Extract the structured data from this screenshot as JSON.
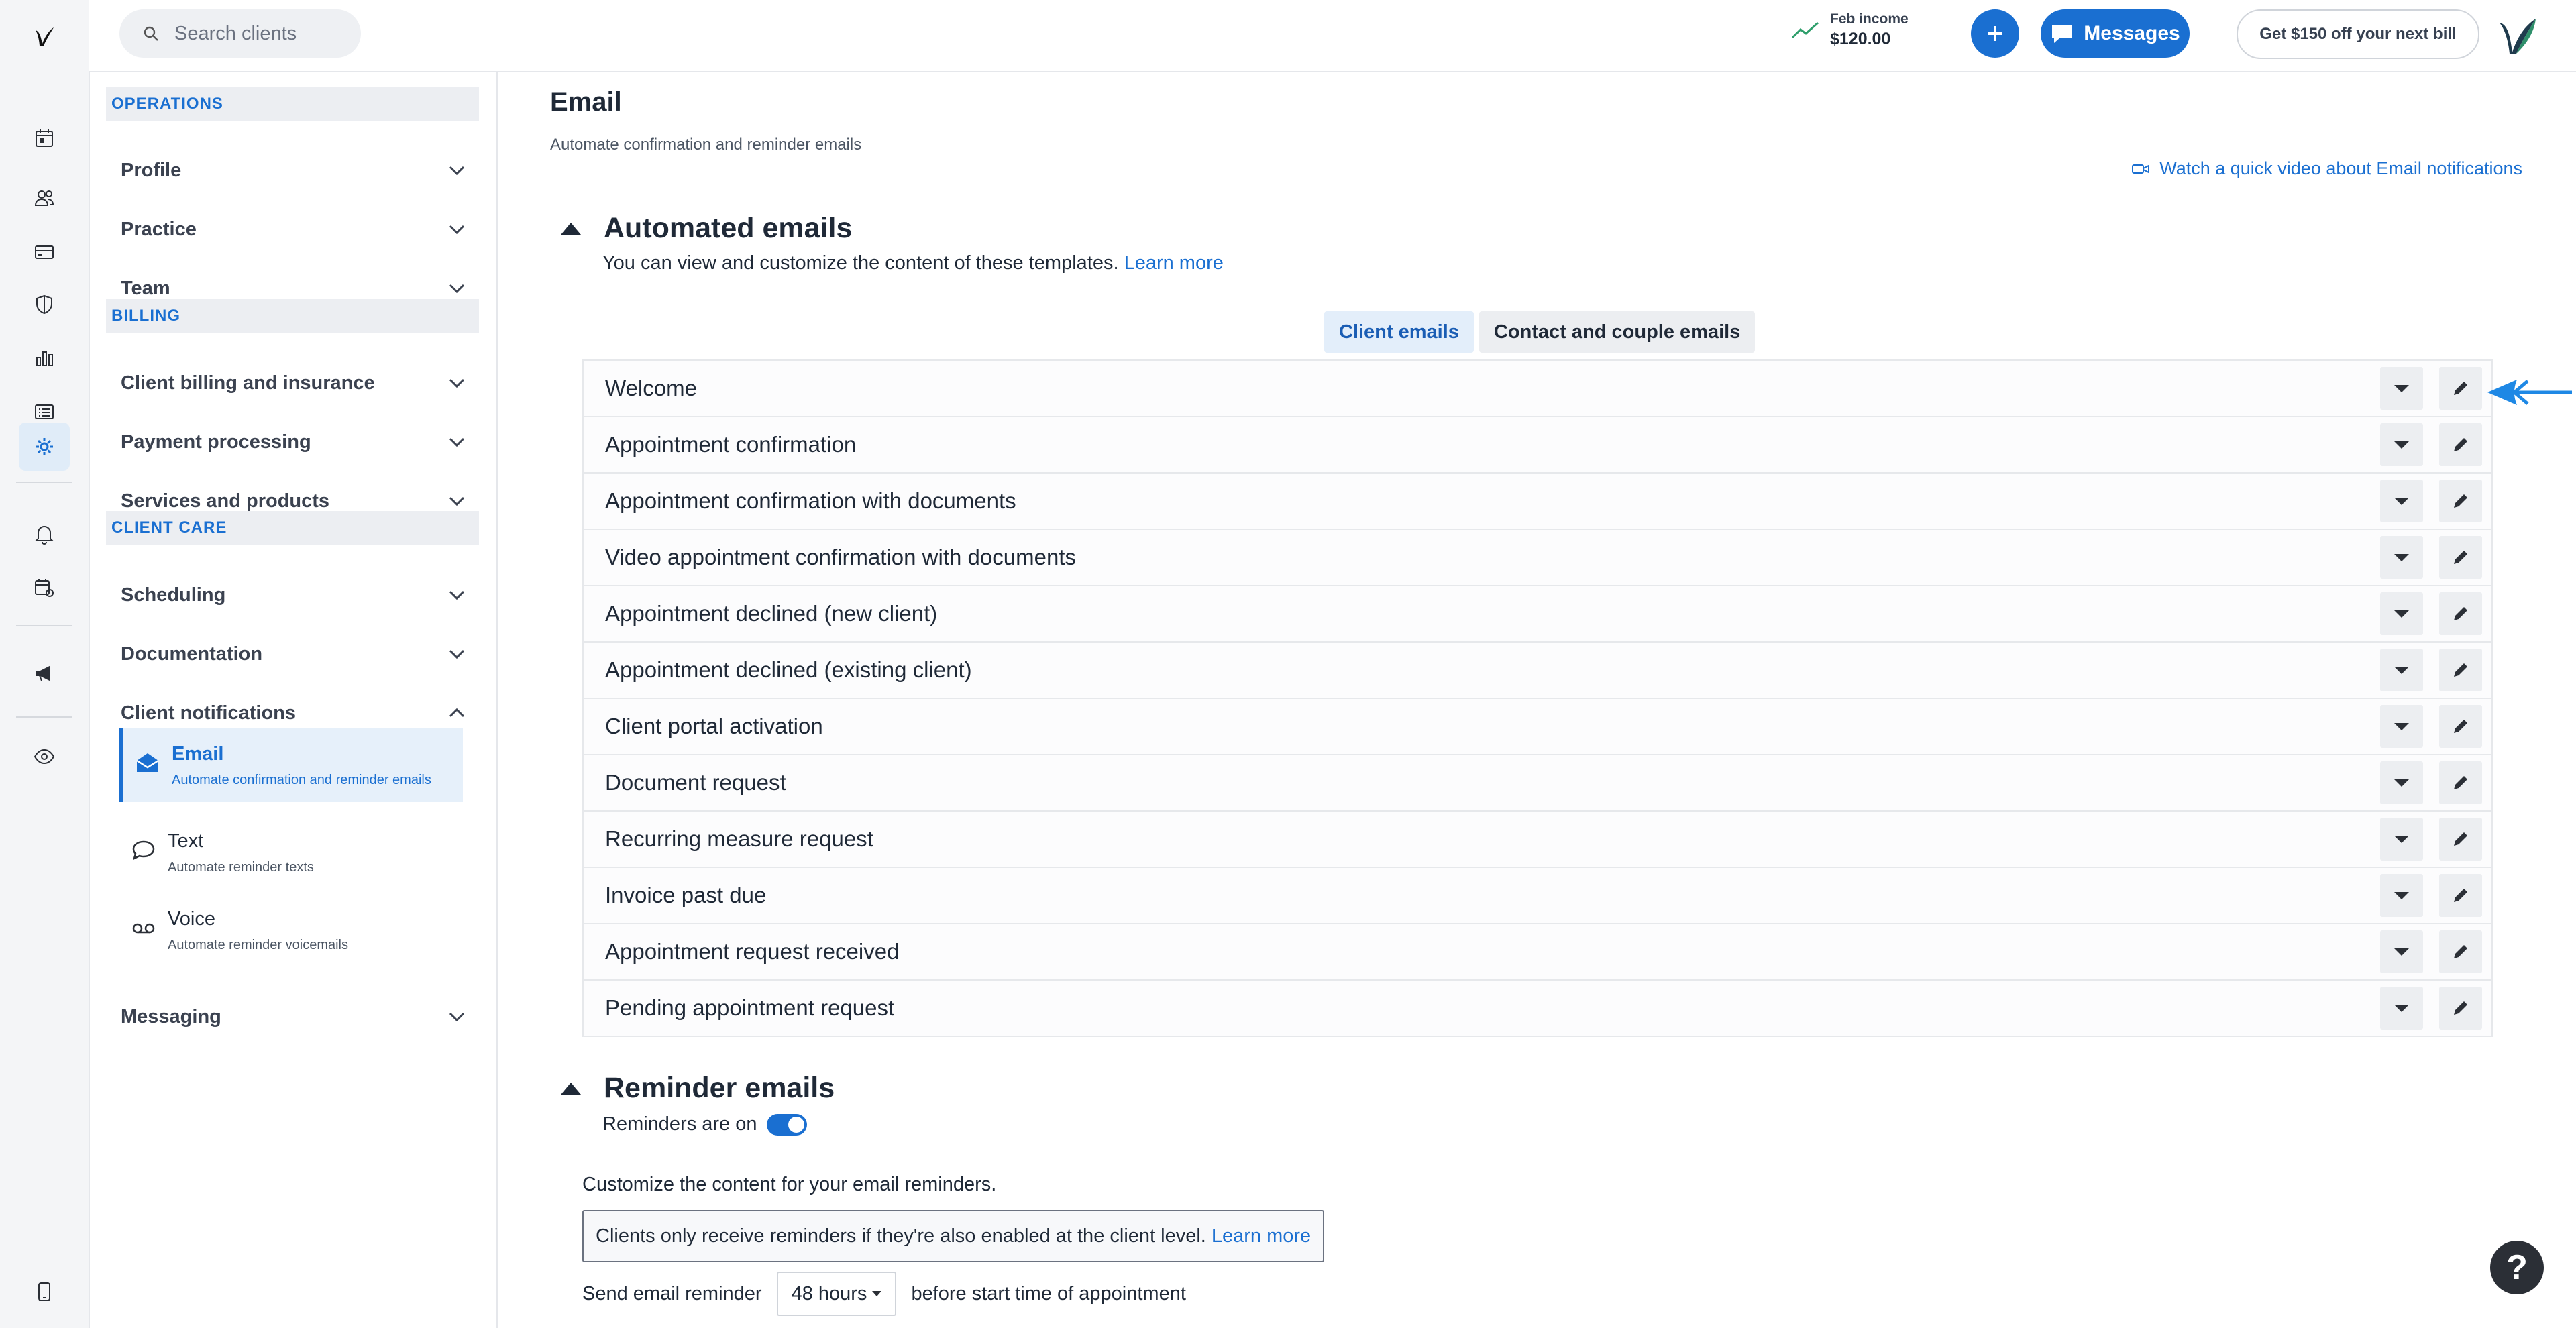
{
  "topbar": {
    "search_placeholder": "Search clients",
    "income_label": "Feb income",
    "income_amount": "$120.00",
    "messages_label": "Messages",
    "promo_label": "Get $150 off your next bill"
  },
  "rail": {
    "icons": [
      "logo-icon",
      "calendar-icon",
      "clients-icon",
      "billing-card-icon",
      "shield-icon",
      "analytics-icon",
      "reports-icon",
      "settings-gear-icon",
      "bell-icon",
      "calendar-settings-icon",
      "megaphone-icon",
      "eye-icon",
      "mobile-icon"
    ],
    "active": "settings-gear-icon"
  },
  "sidebar": {
    "sections": [
      {
        "title": "OPERATIONS",
        "items": [
          "Profile",
          "Practice",
          "Team"
        ]
      },
      {
        "title": "BILLING",
        "items": [
          "Client billing and insurance",
          "Payment processing",
          "Services and products"
        ]
      },
      {
        "title": "CLIENT CARE",
        "items": [
          "Scheduling",
          "Documentation",
          "Client notifications"
        ]
      }
    ],
    "notifications_sub": [
      {
        "label": "Email",
        "desc": "Automate confirmation and reminder emails",
        "icon": "mail-open-icon",
        "active": true
      },
      {
        "label": "Text",
        "desc": "Automate reminder texts",
        "icon": "chat-bubble-icon",
        "active": false
      },
      {
        "label": "Voice",
        "desc": "Automate reminder voicemails",
        "icon": "voicemail-icon",
        "active": false
      }
    ],
    "after_items": [
      "Messaging"
    ]
  },
  "main": {
    "title": "Email",
    "subtitle": "Automate confirmation and reminder emails",
    "video_link": "Watch a quick video about Email notifications",
    "automated": {
      "heading": "Automated emails",
      "intro": "You can view and customize the content of these templates.",
      "learn_more": "Learn more",
      "tabs": [
        "Client emails",
        "Contact and couple emails"
      ],
      "active_tab": "Client emails",
      "templates": [
        "Welcome",
        "Appointment confirmation",
        "Appointment confirmation with documents",
        "Video appointment confirmation with documents",
        "Appointment declined (new client)",
        "Appointment declined (existing client)",
        "Client portal activation",
        "Document request",
        "Recurring measure request",
        "Invoice past due",
        "Appointment request received",
        "Pending appointment request"
      ]
    },
    "reminder": {
      "heading": "Reminder emails",
      "toggle_label": "Reminders are on",
      "toggle_on": true,
      "customize": "Customize the content for your email reminders.",
      "note": "Clients only receive reminders if they're also enabled at the client level.",
      "note_link": "Learn more",
      "send_prefix": "Send email reminder",
      "send_value": "48 hours",
      "send_suffix": "before start time of appointment"
    }
  },
  "help_label": "?",
  "colors": {
    "accent": "#1a6fd1",
    "income_trend": "#2e9e6b",
    "arrow": "#1e88e5"
  }
}
